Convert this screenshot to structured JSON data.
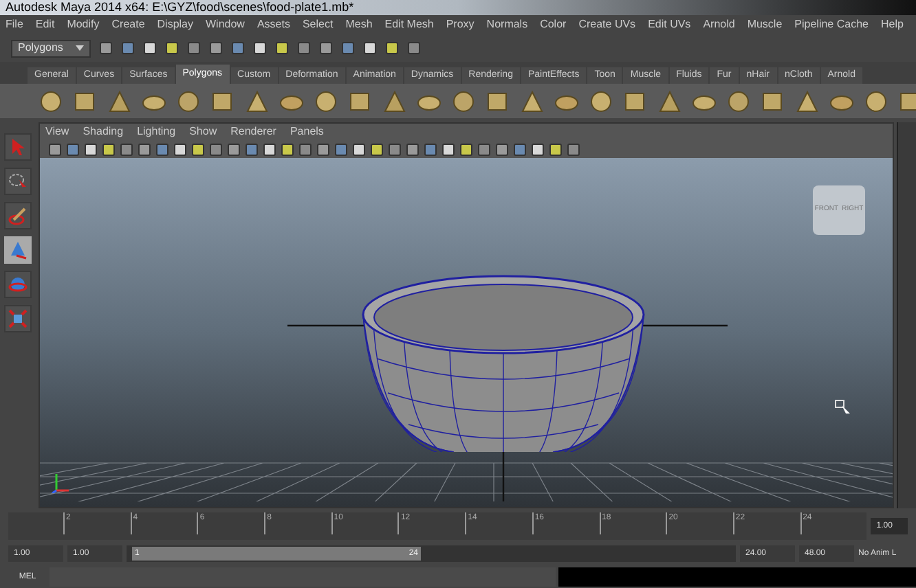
{
  "window": {
    "title": "Autodesk Maya 2014 x64: E:\\GYZ\\food\\scenes\\food-plate1.mb*"
  },
  "menu": [
    "File",
    "Edit",
    "Modify",
    "Create",
    "Display",
    "Window",
    "Assets",
    "Select",
    "Mesh",
    "Edit Mesh",
    "Proxy",
    "Normals",
    "Color",
    "Create UVs",
    "Edit UVs",
    "Arnold",
    "Muscle",
    "Pipeline Cache",
    "Help"
  ],
  "status_line": {
    "menu_set": "Polygons"
  },
  "shelf_tabs": [
    {
      "label": "General",
      "selected": false
    },
    {
      "label": "Curves",
      "selected": false
    },
    {
      "label": "Surfaces",
      "selected": false
    },
    {
      "label": "Polygons",
      "selected": true
    },
    {
      "label": "Custom",
      "selected": false
    },
    {
      "label": "Deformation",
      "selected": false
    },
    {
      "label": "Animation",
      "selected": false
    },
    {
      "label": "Dynamics",
      "selected": false
    },
    {
      "label": "Rendering",
      "selected": false
    },
    {
      "label": "PaintEffects",
      "selected": false
    },
    {
      "label": "Toon",
      "selected": false
    },
    {
      "label": "Muscle",
      "selected": false
    },
    {
      "label": "Fluids",
      "selected": false
    },
    {
      "label": "Fur",
      "selected": false
    },
    {
      "label": "nHair",
      "selected": false
    },
    {
      "label": "nCloth",
      "selected": false
    },
    {
      "label": "Arnold",
      "selected": false
    }
  ],
  "tools": [
    {
      "kind": "select",
      "selected": false
    },
    {
      "kind": "lasso",
      "selected": false
    },
    {
      "kind": "paint",
      "selected": false
    },
    {
      "kind": "move",
      "selected": true
    },
    {
      "kind": "rotate",
      "selected": false
    },
    {
      "kind": "scale",
      "selected": false
    }
  ],
  "panel": {
    "menus": [
      "View",
      "Shading",
      "Lighting",
      "Show",
      "Renderer",
      "Panels"
    ],
    "view_cube": {
      "front": "FRONT",
      "right": "RIGHT"
    }
  },
  "time_slider": {
    "ticks": [
      "2",
      "4",
      "6",
      "8",
      "10",
      "12",
      "14",
      "16",
      "18",
      "20",
      "22",
      "24"
    ],
    "current_frame": "1.00"
  },
  "range_slider": {
    "start": "1.00",
    "range_start": "1.00",
    "handle_start": "1",
    "handle_end": "24",
    "range_end": "24.00",
    "end": "48.00",
    "anim_layer": "No Anim L"
  },
  "command_line": {
    "language": "MEL"
  }
}
